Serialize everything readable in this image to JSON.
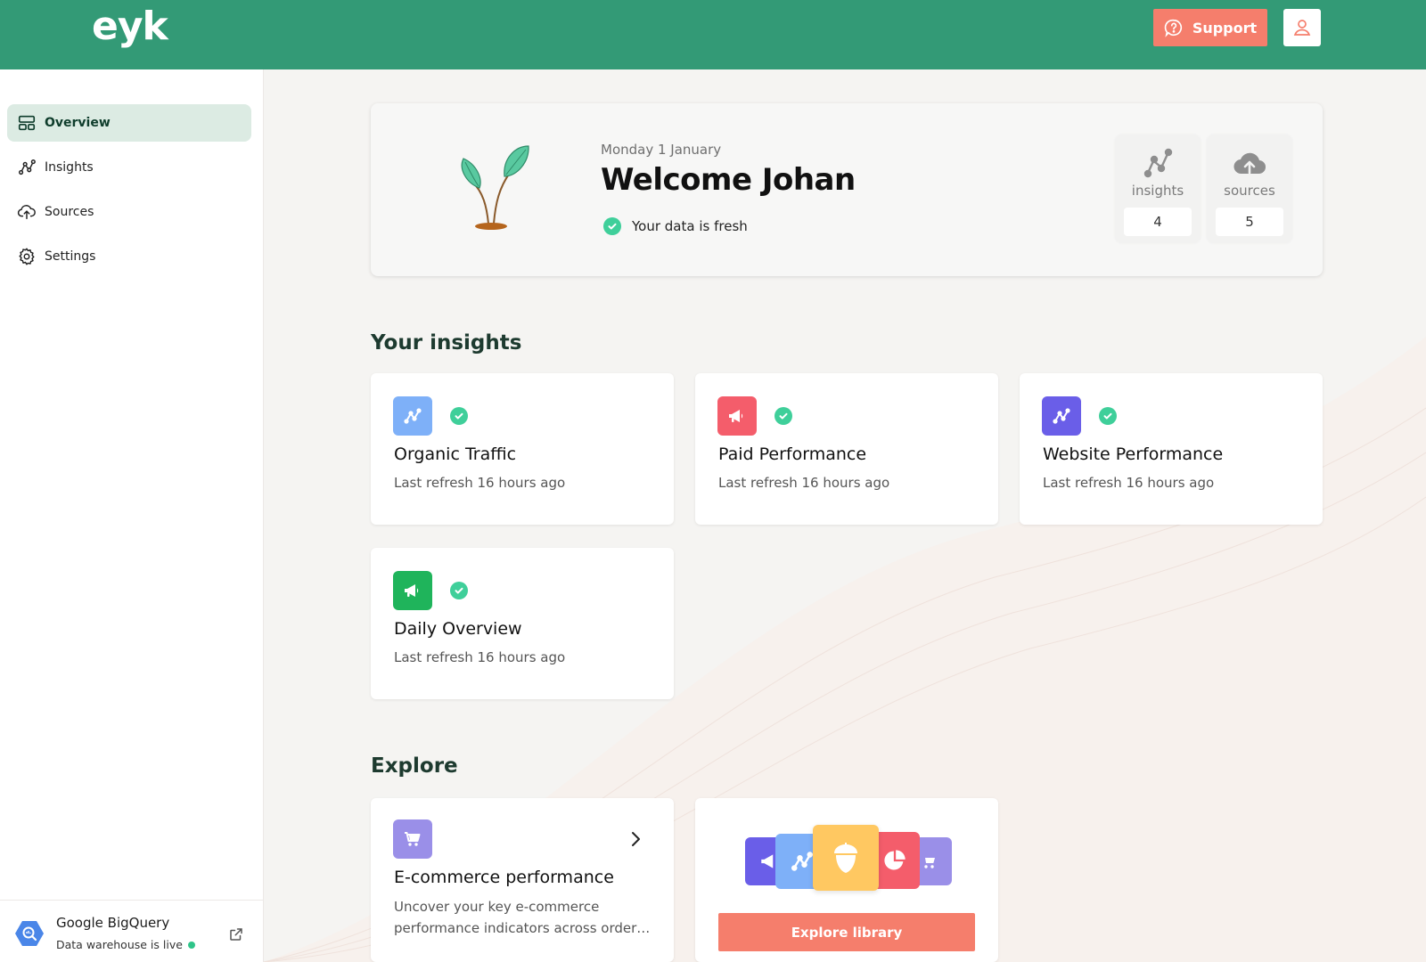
{
  "app": {
    "logo": "eyk"
  },
  "header": {
    "support_label": "Support"
  },
  "sidebar": {
    "items": [
      {
        "label": "Overview",
        "icon": "layout-icon",
        "active": true
      },
      {
        "label": "Insights",
        "icon": "insights-icon",
        "active": false
      },
      {
        "label": "Sources",
        "icon": "cloud-upload-icon",
        "active": false
      },
      {
        "label": "Settings",
        "icon": "gear-icon",
        "active": false
      }
    ],
    "footer": {
      "title": "Google BigQuery",
      "status": "Data warehouse is live"
    }
  },
  "welcome": {
    "date": "Monday 1 January",
    "title": "Welcome Johan",
    "status": "Your data is fresh",
    "stats": [
      {
        "label": "insights",
        "value": "4"
      },
      {
        "label": "sources",
        "value": "5"
      }
    ]
  },
  "insights_section": {
    "title": "Your insights",
    "cards": [
      {
        "title": "Organic Traffic",
        "subtitle": "Last refresh 16 hours ago",
        "icon": "trend-icon",
        "color": "#7eb0f8"
      },
      {
        "title": "Paid Performance",
        "subtitle": "Last refresh 16 hours ago",
        "icon": "megaphone-icon",
        "color": "#f45d6b"
      },
      {
        "title": "Website Performance",
        "subtitle": "Last refresh 16 hours ago",
        "icon": "trend-icon",
        "color": "#6a5ee8"
      },
      {
        "title": "Daily Overview",
        "subtitle": "Last refresh 16 hours ago",
        "icon": "megaphone-icon",
        "color": "#1fb45b"
      }
    ]
  },
  "explore_section": {
    "title": "Explore",
    "card": {
      "title": "E-commerce performance",
      "description": "Uncover your key e-commerce performance indicators across order…",
      "icon": "cart-icon",
      "color": "#9a8fe8"
    },
    "library_button": "Explore library"
  },
  "colors": {
    "brand": "#339a76",
    "accent": "#f57e6c",
    "check": "#3fcf9a"
  }
}
